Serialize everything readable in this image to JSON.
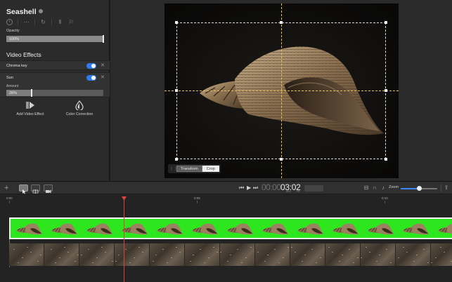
{
  "inspector": {
    "clip_title": "Seashell",
    "opacity_label": "Opacity",
    "opacity_value": "100%",
    "opacity_fraction": 1.0,
    "section_title": "Video Effects",
    "effects": [
      {
        "name": "Chroma key",
        "enabled": true
      },
      {
        "name": "Sun",
        "enabled": true,
        "amount_label": "Amount",
        "amount_value": "26%",
        "amount_fraction": 0.26
      }
    ],
    "add_video_effect_label": "Add Video Effect",
    "color_correction_label": "Color Correction"
  },
  "viewer": {
    "crop_tools": {
      "transform_label": "Transform",
      "crop_label": "Crop",
      "active": "Crop"
    }
  },
  "toolbar": {
    "timecode_dim": "00:00",
    "timecode": "03:02",
    "timecode_units": [
      "SEC",
      "FR"
    ],
    "zoom_label": "Zoom",
    "zoom_fraction": 0.5,
    "icons": [
      "plus-icon",
      "pointer-tool-icon",
      "range-tool-icon",
      "clip-tool-icon",
      "skip-back-icon",
      "play-icon",
      "skip-forward-icon",
      "snapping-icon",
      "magnet-icon",
      "audio-icon",
      "share-icon"
    ]
  },
  "timeline": {
    "ruler_labels": [
      "0:00",
      "0:05",
      "0:10"
    ],
    "playhead_fraction": 0.27,
    "clip_colors": {
      "green_screen": "#2ee61e",
      "playhead": "#d9453d",
      "accent": "#2f7bf5"
    }
  }
}
